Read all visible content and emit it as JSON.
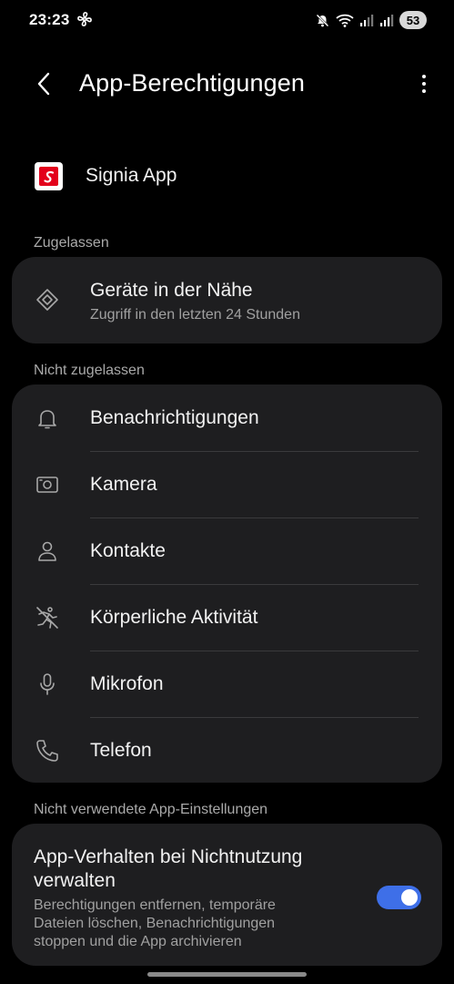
{
  "status_bar": {
    "time": "23:23",
    "battery": "53"
  },
  "header": {
    "title": "App-Berechtigungen"
  },
  "app": {
    "name": "Signia App",
    "logo_color": "#e3001b"
  },
  "allowed": {
    "header": "Zugelassen",
    "items": [
      {
        "title": "Geräte in der Nähe",
        "subtitle": "Zugriff in den letzten 24 Stunden",
        "icon": "nearby-devices-icon"
      }
    ]
  },
  "not_allowed": {
    "header": "Nicht zugelassen",
    "items": [
      {
        "title": "Benachrichtigungen",
        "icon": "bell-icon"
      },
      {
        "title": "Kamera",
        "icon": "camera-icon"
      },
      {
        "title": "Kontakte",
        "icon": "person-icon"
      },
      {
        "title": "Körperliche Aktivität",
        "icon": "activity-icon"
      },
      {
        "title": "Mikrofon",
        "icon": "microphone-icon"
      },
      {
        "title": "Telefon",
        "icon": "phone-icon"
      }
    ]
  },
  "unused_settings": {
    "header": "Nicht verwendete App-Einstellungen",
    "toggle_title": "App-Verhalten bei Nichtnutzung verwalten",
    "toggle_description": "Berechtigungen entfernen, temporäre Dateien löschen, Benachrichtigungen stoppen und die App archivieren",
    "toggle_on": true,
    "accent_color": "#3e6fe8"
  }
}
